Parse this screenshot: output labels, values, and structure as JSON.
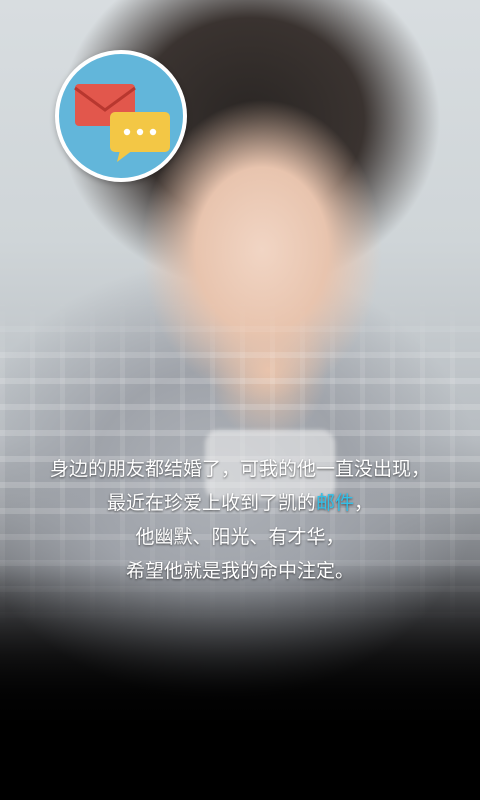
{
  "caption": {
    "line1": "身边的朋友都结婚了，可我的他一直没出现，",
    "line2_prefix": "最近在珍爱上收到了凯的",
    "line2_highlight": "邮件",
    "line2_suffix": "，",
    "line3": "他幽默、阳光、有才华，",
    "line4": "希望他就是我的命中注定。"
  },
  "icon": {
    "name": "mail-message-icon",
    "badge_color": "#62b6da",
    "envelope_color": "#e2574c",
    "bubble_color": "#f3c745"
  },
  "colors": {
    "highlight": "#33c0e8",
    "text": "#ffffff"
  }
}
